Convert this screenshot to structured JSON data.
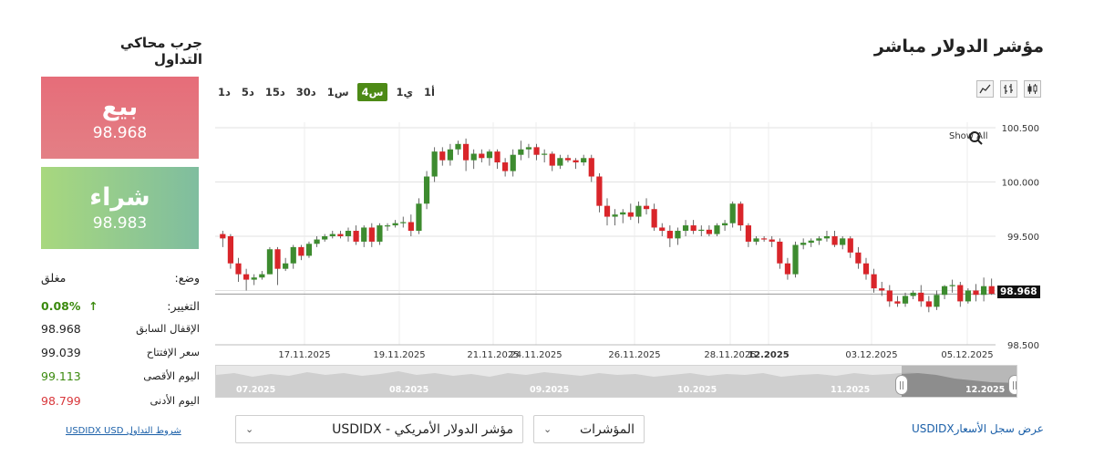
{
  "header": {
    "title": "مؤشر الدولار مباشر",
    "simulator_title": "جرب محاكي التداول"
  },
  "timeframes": [
    "1أ",
    "1ي",
    "4س",
    "1س",
    "30د",
    "15د",
    "5د",
    "1د"
  ],
  "active_timeframe": "4س",
  "chart_type_icons": [
    "line-chart-icon",
    "ohlc-chart-icon",
    "candlestick-chart-icon"
  ],
  "chart": {
    "show_all_label": "Show All",
    "current_price_label": "98.968",
    "y_ticks": [
      "100.500",
      "100.000",
      "99.500",
      "98.500"
    ],
    "x_ticks": [
      "17.11.2025",
      "19.11.2025",
      "21.11.2025",
      "24.11.2025",
      "26.11.2025",
      "28.11.2025",
      "12.2025",
      "03.12.2025",
      "05.12.2025"
    ]
  },
  "navigator": {
    "labels": [
      "07.2025",
      "08.2025",
      "09.2025",
      "10.2025",
      "11.2025",
      "12.2025"
    ]
  },
  "trade": {
    "sell_label": "بيع",
    "sell_price": "98.968",
    "buy_label": "شراء",
    "buy_price": "98.983"
  },
  "stats": {
    "status_key": "وضع:",
    "status_val": "مغلق",
    "change_key": "التغيير:",
    "change_val": "0.08%",
    "prev_close_key": "الإقفال السابق",
    "prev_close_val": "98.968",
    "open_key": "سعر الإفتتاح",
    "open_val": "99.039",
    "high_key": "اليوم الأقصى",
    "high_val": "99.113",
    "low_key": "اليوم الأدنى",
    "low_val": "98.799"
  },
  "footer": {
    "conditions_link": "USDIDX USD شروط التداول",
    "history_link": "USDIDXعرض سجل الأسعار",
    "instrument_select": "USDIDX - مؤشر الدولار الأمريكي",
    "category_select": "المؤشرات"
  },
  "colors": {
    "up": "#3d8b2f",
    "down": "#d9252a",
    "active_tf": "#4d8a16"
  },
  "chart_data": {
    "type": "candlestick",
    "y_range": [
      98.5,
      100.55
    ],
    "x_tick_labels": [
      "17.11.2025",
      "19.11.2025",
      "21.11.2025",
      "24.11.2025",
      "26.11.2025",
      "28.11.2025",
      "12.2025",
      "03.12.2025",
      "05.12.2025"
    ],
    "y_tick_labels": [
      "100.500",
      "100.000",
      "99.500",
      "98.500"
    ],
    "last_price": 98.968,
    "candles": [
      [
        99.52,
        99.55,
        99.4,
        99.48
      ],
      [
        99.5,
        99.52,
        99.2,
        99.25
      ],
      [
        99.25,
        99.3,
        99.08,
        99.15
      ],
      [
        99.15,
        99.2,
        99.0,
        99.1
      ],
      [
        99.1,
        99.15,
        99.05,
        99.12
      ],
      [
        99.12,
        99.18,
        99.1,
        99.15
      ],
      [
        99.15,
        99.4,
        99.15,
        99.38
      ],
      [
        99.38,
        99.4,
        99.05,
        99.2
      ],
      [
        99.2,
        99.3,
        99.18,
        99.25
      ],
      [
        99.25,
        99.42,
        99.2,
        99.4
      ],
      [
        99.4,
        99.42,
        99.28,
        99.32
      ],
      [
        99.32,
        99.45,
        99.3,
        99.43
      ],
      [
        99.43,
        99.5,
        99.4,
        99.47
      ],
      [
        99.47,
        99.52,
        99.45,
        99.5
      ],
      [
        99.5,
        99.55,
        99.48,
        99.52
      ],
      [
        99.52,
        99.55,
        99.48,
        99.5
      ],
      [
        99.5,
        99.58,
        99.45,
        99.55
      ],
      [
        99.55,
        99.6,
        99.42,
        99.45
      ],
      [
        99.45,
        99.6,
        99.4,
        99.58
      ],
      [
        99.58,
        99.62,
        99.4,
        99.45
      ],
      [
        99.45,
        99.62,
        99.42,
        99.6
      ],
      [
        99.6,
        99.62,
        99.55,
        99.6
      ],
      [
        99.6,
        99.65,
        99.58,
        99.62
      ],
      [
        99.62,
        99.68,
        99.58,
        99.63
      ],
      [
        99.63,
        99.7,
        99.5,
        99.55
      ],
      [
        99.55,
        99.85,
        99.52,
        99.8
      ],
      [
        99.8,
        100.1,
        99.75,
        100.05
      ],
      [
        100.05,
        100.32,
        100.0,
        100.28
      ],
      [
        100.28,
        100.32,
        100.15,
        100.2
      ],
      [
        100.2,
        100.35,
        100.15,
        100.3
      ],
      [
        100.3,
        100.38,
        100.25,
        100.35
      ],
      [
        100.35,
        100.4,
        100.1,
        100.2
      ],
      [
        100.2,
        100.3,
        100.12,
        100.26
      ],
      [
        100.26,
        100.3,
        100.18,
        100.22
      ],
      [
        100.22,
        100.3,
        100.15,
        100.28
      ],
      [
        100.28,
        100.3,
        100.12,
        100.18
      ],
      [
        100.18,
        100.22,
        100.05,
        100.1
      ],
      [
        100.1,
        100.3,
        100.05,
        100.25
      ],
      [
        100.25,
        100.38,
        100.2,
        100.3
      ],
      [
        100.3,
        100.35,
        100.22,
        100.32
      ],
      [
        100.32,
        100.35,
        100.2,
        100.25
      ],
      [
        100.25,
        100.3,
        100.18,
        100.26
      ],
      [
        100.26,
        100.28,
        100.1,
        100.15
      ],
      [
        100.15,
        100.25,
        100.12,
        100.22
      ],
      [
        100.22,
        100.25,
        100.18,
        100.2
      ],
      [
        100.2,
        100.22,
        100.12,
        100.18
      ],
      [
        100.18,
        100.25,
        100.15,
        100.22
      ],
      [
        100.22,
        100.25,
        100.0,
        100.05
      ],
      [
        100.05,
        100.08,
        99.72,
        99.78
      ],
      [
        99.78,
        99.85,
        99.6,
        99.68
      ],
      [
        99.68,
        99.75,
        99.6,
        99.7
      ],
      [
        99.7,
        99.75,
        99.62,
        99.72
      ],
      [
        99.72,
        99.8,
        99.65,
        99.68
      ],
      [
        99.68,
        99.82,
        99.62,
        99.78
      ],
      [
        99.78,
        99.85,
        99.7,
        99.75
      ],
      [
        99.75,
        99.8,
        99.55,
        99.58
      ],
      [
        99.58,
        99.62,
        99.5,
        99.55
      ],
      [
        99.55,
        99.6,
        99.4,
        99.48
      ],
      [
        99.48,
        99.58,
        99.42,
        99.55
      ],
      [
        99.55,
        99.65,
        99.5,
        99.6
      ],
      [
        99.6,
        99.65,
        99.52,
        99.55
      ],
      [
        99.55,
        99.6,
        99.5,
        99.56
      ],
      [
        99.56,
        99.6,
        99.5,
        99.52
      ],
      [
        99.52,
        99.62,
        99.5,
        99.6
      ],
      [
        99.6,
        99.65,
        99.55,
        99.62
      ],
      [
        99.62,
        99.82,
        99.58,
        99.8
      ],
      [
        99.8,
        99.82,
        99.55,
        99.6
      ],
      [
        99.6,
        99.62,
        99.4,
        99.45
      ],
      [
        99.45,
        99.5,
        99.42,
        99.48
      ],
      [
        99.48,
        99.5,
        99.45,
        99.47
      ],
      [
        99.47,
        99.5,
        99.4,
        99.45
      ],
      [
        99.45,
        99.48,
        99.2,
        99.25
      ],
      [
        99.25,
        99.3,
        99.1,
        99.15
      ],
      [
        99.15,
        99.45,
        99.12,
        99.42
      ],
      [
        99.42,
        99.48,
        99.38,
        99.44
      ],
      [
        99.44,
        99.48,
        99.4,
        99.46
      ],
      [
        99.46,
        99.5,
        99.42,
        99.48
      ],
      [
        99.48,
        99.55,
        99.45,
        99.5
      ],
      [
        99.5,
        99.55,
        99.4,
        99.42
      ],
      [
        99.42,
        99.5,
        99.38,
        99.48
      ],
      [
        99.48,
        99.5,
        99.3,
        99.35
      ],
      [
        99.35,
        99.4,
        99.2,
        99.25
      ],
      [
        99.25,
        99.3,
        99.1,
        99.15
      ],
      [
        99.15,
        99.2,
        98.98,
        99.02
      ],
      [
        99.02,
        99.08,
        98.95,
        99.0
      ],
      [
        99.0,
        99.05,
        98.85,
        98.9
      ],
      [
        98.9,
        98.95,
        98.85,
        98.88
      ],
      [
        98.88,
        98.98,
        98.85,
        98.95
      ],
      [
        98.95,
        99.0,
        98.92,
        98.98
      ],
      [
        98.98,
        99.05,
        98.85,
        98.9
      ],
      [
        98.9,
        98.95,
        98.8,
        98.85
      ],
      [
        98.85,
        99.0,
        98.82,
        98.96
      ],
      [
        98.96,
        99.05,
        98.92,
        99.04
      ],
      [
        99.04,
        99.1,
        98.98,
        99.05
      ],
      [
        99.05,
        99.08,
        98.85,
        98.9
      ],
      [
        98.9,
        99.02,
        98.88,
        99.0
      ],
      [
        99.0,
        99.06,
        98.9,
        98.96
      ],
      [
        98.96,
        99.12,
        98.9,
        99.04
      ],
      [
        99.04,
        99.11,
        98.96,
        98.97
      ]
    ]
  }
}
